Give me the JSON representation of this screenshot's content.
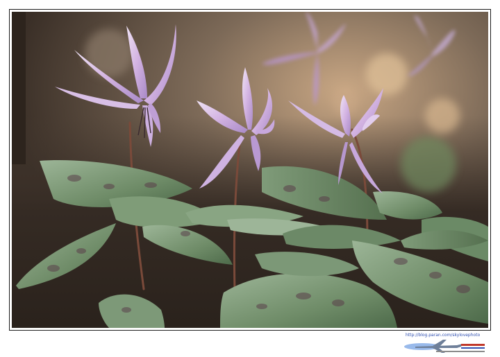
{
  "photo": {
    "subject": "flowers",
    "palette": {
      "background_top": "#8b7a68",
      "background_mid": "#5a4a3c",
      "soil": "#2e2620",
      "leaf": "#5f7d5a",
      "leaf_light": "#93ad8e",
      "leaf_spot": "#5a3f4a",
      "petal": "#c9a6d9",
      "petal_light": "#e4d2ee",
      "stem": "#7a4a3a"
    }
  },
  "watermark": {
    "url_text": "http://blog.paran.com/skylovephoto",
    "icon": "airplane-logo-icon"
  }
}
